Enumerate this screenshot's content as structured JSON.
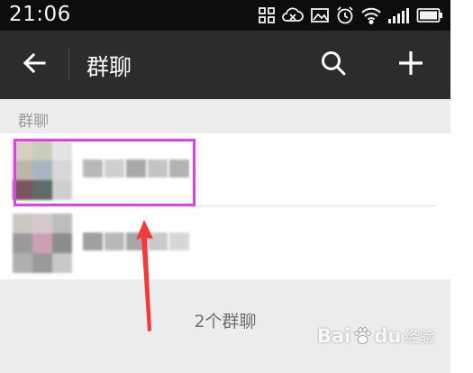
{
  "status_bar": {
    "time": "21:06",
    "icons": [
      "grid-icon",
      "cloud-x-icon",
      "image-icon",
      "alarm-icon",
      "wifi-icon",
      "signal-icon",
      "battery-icon"
    ]
  },
  "action_bar": {
    "title": "群聊",
    "back_icon": "arrow-left-icon",
    "search_icon": "search-icon",
    "add_icon": "plus-icon",
    "background": "#2c2c2c"
  },
  "section_header": "群聊",
  "group_list": {
    "items": [
      {
        "name": "",
        "highlighted": true
      },
      {
        "name": "",
        "highlighted": false
      }
    ]
  },
  "group_count": "2个群聊",
  "annotation": {
    "highlight_color": "#e040e8",
    "arrow_color": "#f23a3a"
  },
  "watermark": {
    "brand": "Bai",
    "brand_suffix": "du",
    "label": "经验"
  }
}
